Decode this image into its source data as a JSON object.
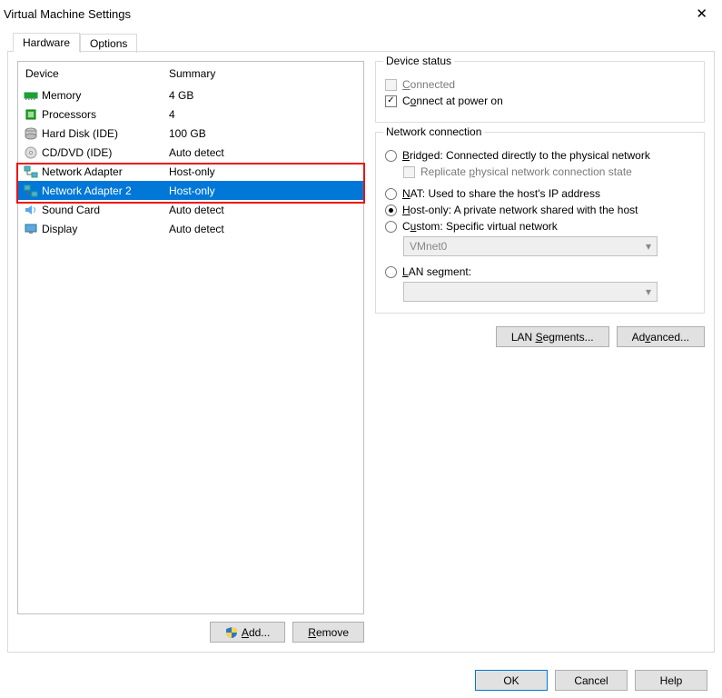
{
  "window": {
    "title": "Virtual Machine Settings",
    "close_icon": "close-icon"
  },
  "tabs": {
    "active": "Hardware",
    "inactive": "Options"
  },
  "device_list": {
    "header_device": "Device",
    "header_summary": "Summary",
    "items": [
      {
        "icon": "memory-icon",
        "name": "Memory",
        "summary": "4 GB"
      },
      {
        "icon": "cpu-icon",
        "name": "Processors",
        "summary": "4"
      },
      {
        "icon": "hdd-icon",
        "name": "Hard Disk (IDE)",
        "summary": "100 GB"
      },
      {
        "icon": "cd-icon",
        "name": "CD/DVD (IDE)",
        "summary": "Auto detect"
      },
      {
        "icon": "nic-icon",
        "name": "Network Adapter",
        "summary": "Host-only"
      },
      {
        "icon": "nic-icon",
        "name": "Network Adapter 2",
        "summary": "Host-only",
        "selected": true
      },
      {
        "icon": "sound-icon",
        "name": "Sound Card",
        "summary": "Auto detect"
      },
      {
        "icon": "display-icon",
        "name": "Display",
        "summary": "Auto detect"
      }
    ]
  },
  "left_buttons": {
    "add": "Add...",
    "remove": "Remove"
  },
  "status_group": {
    "title": "Device status",
    "connected": "Connected",
    "connect_on_power": "Connect at power on"
  },
  "net_group": {
    "title": "Network connection",
    "bridged": "Bridged: Connected directly to the physical network",
    "replicate": "Replicate physical network connection state",
    "nat": "NAT: Used to share the host's IP address",
    "hostonly": "Host-only: A private network shared with the host",
    "custom": "Custom: Specific virtual network",
    "custom_combo": "VMnet0",
    "lanseg": "LAN segment:",
    "lanseg_combo": ""
  },
  "right_buttons": {
    "lan_segments": "LAN Segments...",
    "advanced": "Advanced..."
  },
  "bottom_buttons": {
    "ok": "OK",
    "cancel": "Cancel",
    "help": "Help"
  }
}
